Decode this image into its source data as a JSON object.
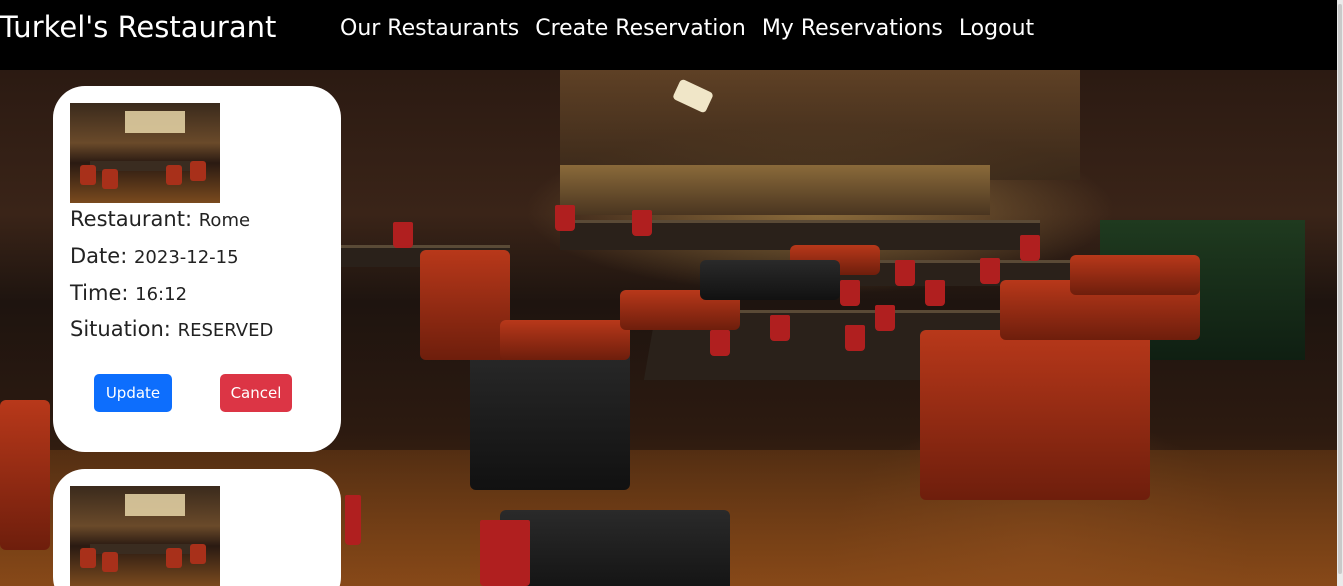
{
  "navbar": {
    "brand": "Turkel's Restaurant",
    "links": [
      "Our Restaurants",
      "Create Reservation",
      "My Reservations",
      "Logout"
    ]
  },
  "reservations": [
    {
      "restaurant_label": "Restaurant:",
      "restaurant": "Rome",
      "date_label": "Date:",
      "date": "2023-12-15",
      "time_label": "Time:",
      "time": "16:12",
      "situation_label": "Situation:",
      "situation": "RESERVED",
      "update_label": "Update",
      "cancel_label": "Cancel"
    }
  ],
  "colors": {
    "navbar_bg": "#000000",
    "update_button": "#0d6efd",
    "cancel_button": "#dc3545",
    "card_bg": "#ffffff"
  },
  "icons": {
    "restaurant_thumbnail": "restaurant-photo"
  }
}
